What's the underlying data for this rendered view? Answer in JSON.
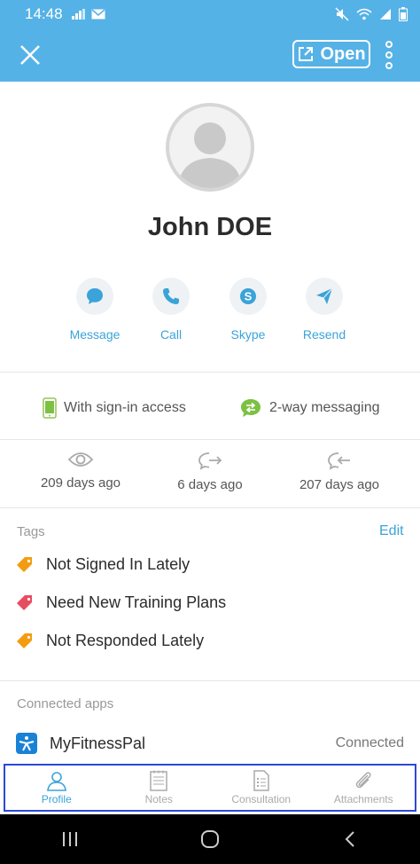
{
  "status_bar": {
    "time": "14:48"
  },
  "header": {
    "open_label": "Open"
  },
  "profile": {
    "name": "John DOE"
  },
  "actions": [
    {
      "label": "Message"
    },
    {
      "label": "Call"
    },
    {
      "label": "Skype"
    },
    {
      "label": "Resend"
    }
  ],
  "features": [
    {
      "label": "With sign-in access"
    },
    {
      "label": "2-way messaging"
    }
  ],
  "stats": [
    {
      "value": "209 days ago"
    },
    {
      "value": "6 days ago"
    },
    {
      "value": "207 days ago"
    }
  ],
  "tags": {
    "title": "Tags",
    "edit_label": "Edit",
    "items": [
      {
        "label": "Not Signed In Lately",
        "color": "#f39c12"
      },
      {
        "label": "Need New Training Plans",
        "color": "#e84c5f"
      },
      {
        "label": "Not Responded Lately",
        "color": "#f39c12"
      }
    ]
  },
  "connected_apps": {
    "title": "Connected apps",
    "items": [
      {
        "name": "MyFitnessPal",
        "status": "Connected"
      }
    ]
  },
  "bottom_nav": {
    "items": [
      {
        "label": "Profile",
        "active": true
      },
      {
        "label": "Notes"
      },
      {
        "label": "Consultation"
      },
      {
        "label": "Attachments"
      }
    ]
  },
  "colors": {
    "primary": "#55b2e6",
    "accent": "#3aa3d9",
    "highlight_border": "#2b49d6"
  }
}
